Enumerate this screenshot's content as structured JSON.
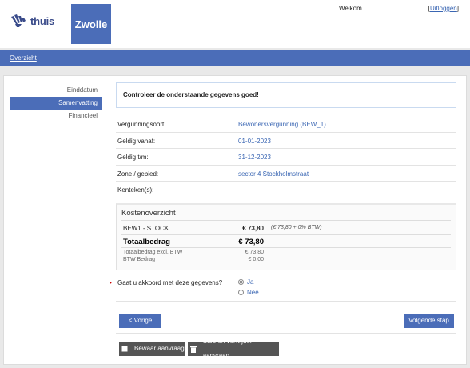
{
  "header": {
    "logo_text": "thuis",
    "city": "Zwolle",
    "welcome": "Welkom",
    "logout_open": "[",
    "logout_label": "Uitloggen",
    "logout_close": "]"
  },
  "nav": {
    "overview": "Overzicht"
  },
  "sidebar": {
    "items": [
      {
        "label": "Einddatum",
        "active": false
      },
      {
        "label": "Samenvatting",
        "active": true
      },
      {
        "label": "Financieel",
        "active": false
      }
    ]
  },
  "main": {
    "notice": "Controleer de onderstaande gegevens goed!",
    "rows": [
      {
        "label": "Vergunningsoort:",
        "value": "Bewonersvergunning (BEW_1)"
      },
      {
        "label": "Geldig vanaf:",
        "value": "01-01-2023"
      },
      {
        "label": "Geldig t/m:",
        "value": "31-12-2023"
      },
      {
        "label": "Zone / gebied:",
        "value": "sector 4 Stockholmstraat"
      },
      {
        "label": "Kenteken(s):",
        "value": ""
      }
    ]
  },
  "costs": {
    "title": "Kostenoverzicht",
    "item_name": "BEW1 - STOCK",
    "item_amount": "€ 73,80",
    "item_note": "(€ 73,80 + 0% BTW)",
    "total_label": "Totaalbedrag",
    "total_amount": "€ 73,80",
    "excl_label": "Totaalbedrag excl. BTW",
    "excl_amount": "€ 73,80",
    "btw_label": "BTW Bedrag",
    "btw_amount": "€ 0,00"
  },
  "question": {
    "required_mark": "•",
    "label": "Gaat u akkoord met deze gegevens?",
    "options": [
      {
        "label": "Ja",
        "checked": true
      },
      {
        "label": "Nee",
        "checked": false
      }
    ]
  },
  "buttons": {
    "prev": "< Vorige stap",
    "next": "Volgende stap >",
    "save": "Bewaar aanvraag",
    "stop": "Stop en verwijder aanvraag"
  },
  "colors": {
    "brand_blue": "#4b6db8",
    "link_blue": "#3a66b3",
    "dark_button": "#555555"
  }
}
